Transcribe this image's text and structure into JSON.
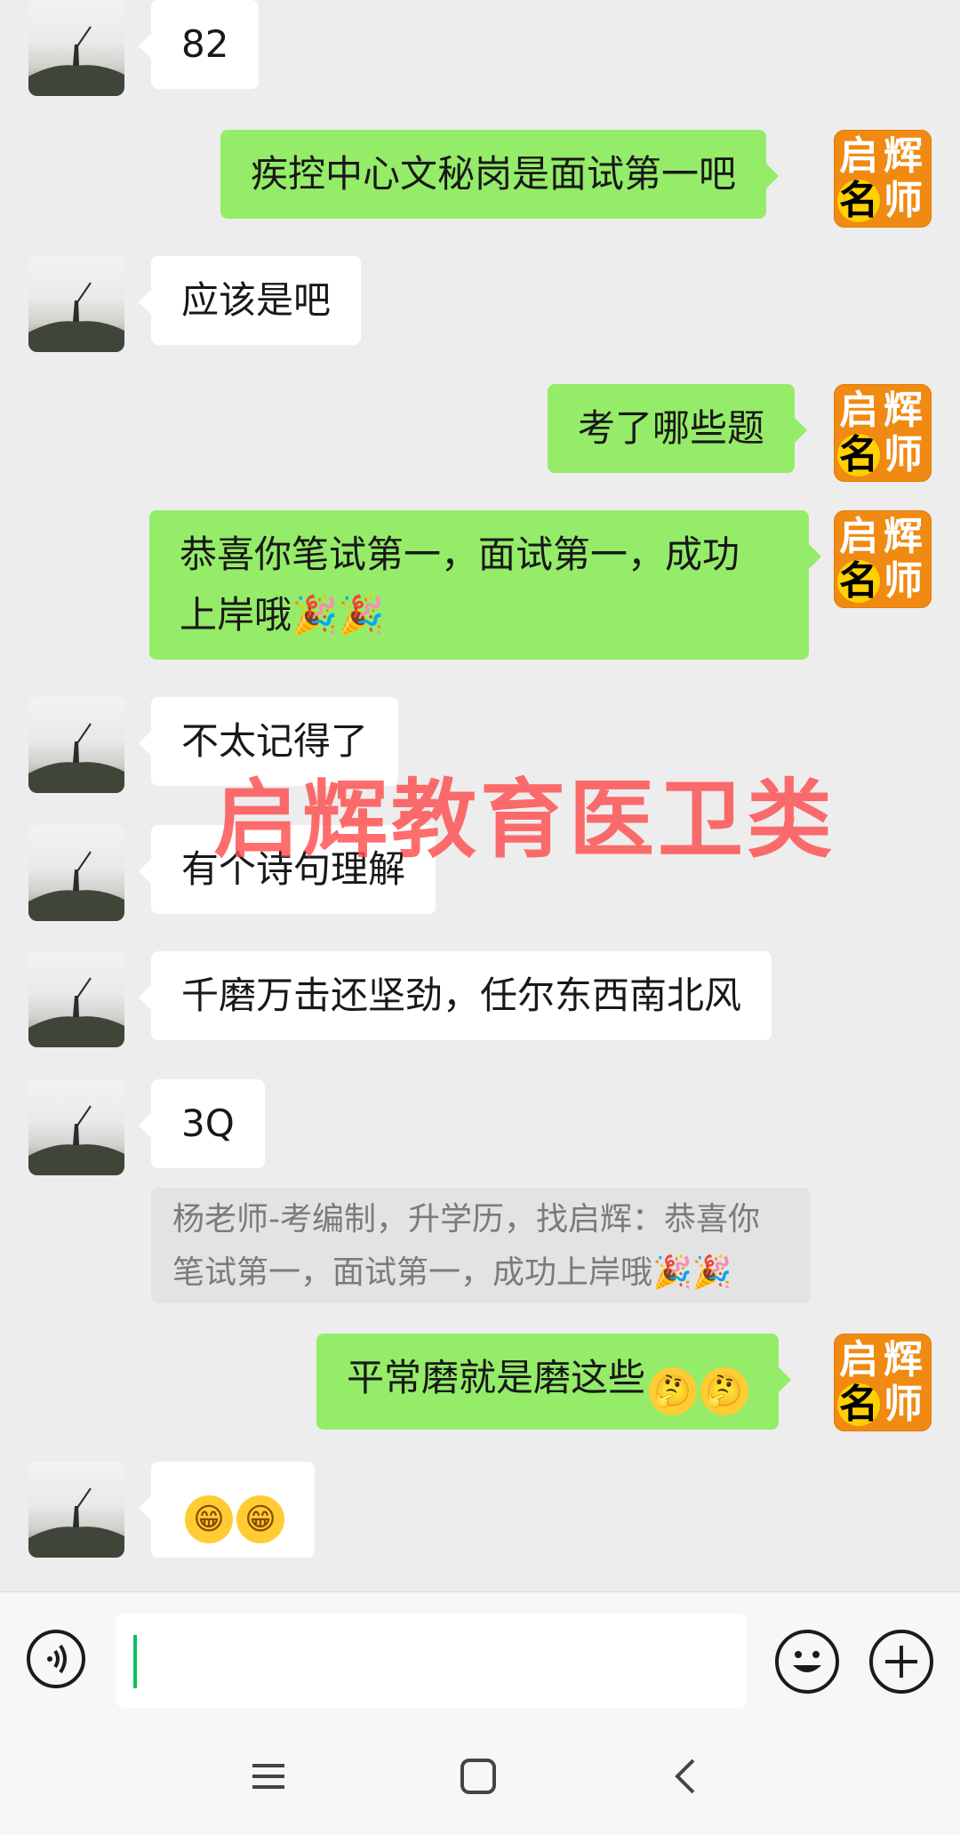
{
  "messages": [
    {
      "side": "in",
      "text": "82"
    },
    {
      "side": "out",
      "text": "疾控中心文秘岗是面试第一吧"
    },
    {
      "side": "in",
      "text": "应该是吧"
    },
    {
      "side": "out",
      "text": "考了哪些题"
    },
    {
      "side": "out",
      "line1": "恭喜你笔试第一，面试第一，成功",
      "line2": "上岸哦"
    },
    {
      "side": "in",
      "text": "不太记得了"
    },
    {
      "side": "in",
      "text": "有个诗句理解"
    },
    {
      "side": "in",
      "text": "千磨万击还坚劲，任尔东西南北风"
    },
    {
      "side": "in",
      "text": "3Q"
    },
    {
      "side": "out",
      "text": "平常磨就是磨这些"
    },
    {
      "side": "in",
      "text": ""
    }
  ],
  "quote": {
    "line1": "杨老师-考编制，升学历，找启辉：恭喜你",
    "line2": "笔试第一，面试第一，成功上岸哦"
  },
  "badge": {
    "c1": "启",
    "c2": "辉",
    "c3": "名",
    "c4": "师"
  },
  "watermark": "启辉教育医卫类",
  "emoji": {
    "party": "🎉",
    "thinking": "🤔",
    "grin": "😁"
  },
  "input": {
    "placeholder": ""
  },
  "colors": {
    "outgoing": "#95ec69",
    "incoming": "#ffffff",
    "background": "#ededed",
    "badge": "#f08a12",
    "watermark": "#ff4e4e",
    "cursor": "#07c160"
  }
}
